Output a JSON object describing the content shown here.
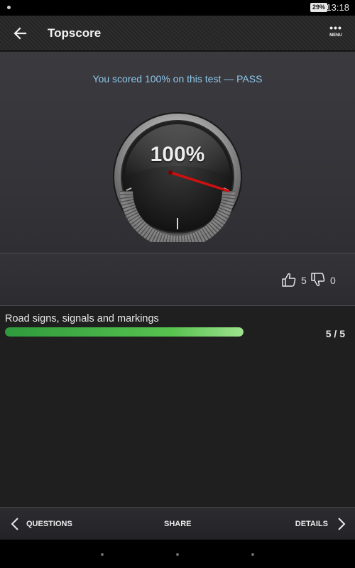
{
  "status_bar": {
    "battery": "29%",
    "time": "13:18"
  },
  "app_bar": {
    "title": "Topscore",
    "back_icon": "arrow-left-icon",
    "menu_icon": "more-dots-icon",
    "menu_label": "MENU"
  },
  "result": {
    "message": "You scored 100% on this test — PASS",
    "percent_label": "100%",
    "percent": 100
  },
  "votes": {
    "up_icon": "thumbs-up-icon",
    "up_count": "5",
    "down_icon": "thumbs-down-icon",
    "down_count": "0"
  },
  "categories": [
    {
      "name": "Road signs, signals and markings",
      "score": "5 / 5",
      "progress": 1.0
    }
  ],
  "bottom_bar": {
    "questions_label": "QUESTIONS",
    "share_label": "SHARE",
    "details_label": "DETAILS"
  },
  "colors": {
    "accent_text": "#8fc8ea",
    "progress": "#58c34f",
    "needle": "#d01010"
  }
}
